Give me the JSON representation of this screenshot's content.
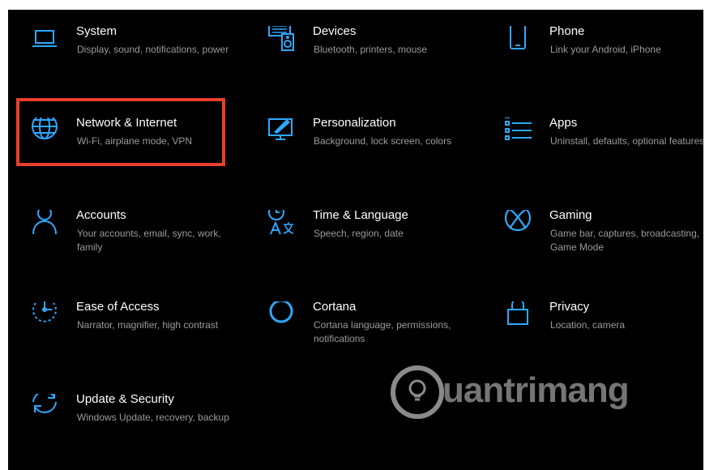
{
  "theme": {
    "accent": "#2ea8ff",
    "highlight": "#e8402b",
    "background": "#000000",
    "title_color": "#ffffff",
    "desc_color": "#9b9b9b"
  },
  "tiles": [
    {
      "icon": "laptop-icon",
      "title": "System",
      "desc": "Display, sound, notifications, power"
    },
    {
      "icon": "keyboard-speaker-icon",
      "title": "Devices",
      "desc": "Bluetooth, printers, mouse"
    },
    {
      "icon": "phone-icon",
      "title": "Phone",
      "desc": "Link your Android, iPhone"
    },
    {
      "icon": "globe-icon",
      "title": "Network & Internet",
      "desc": "Wi-Fi, airplane mode, VPN"
    },
    {
      "icon": "paint-screen-icon",
      "title": "Personalization",
      "desc": "Background, lock screen, colors"
    },
    {
      "icon": "list-icon",
      "title": "Apps",
      "desc": "Uninstall, defaults, optional features"
    },
    {
      "icon": "person-icon",
      "title": "Accounts",
      "desc": "Your accounts, email, sync, work, family"
    },
    {
      "icon": "time-language-icon",
      "title": "Time & Language",
      "desc": "Speech, region, date"
    },
    {
      "icon": "xbox-icon",
      "title": "Gaming",
      "desc": "Game bar, captures, broadcasting, Game Mode"
    },
    {
      "icon": "ease-of-access-icon",
      "title": "Ease of Access",
      "desc": "Narrator, magnifier, high contrast"
    },
    {
      "icon": "cortana-icon",
      "title": "Cortana",
      "desc": "Cortana language, permissions, notifications"
    },
    {
      "icon": "lock-icon",
      "title": "Privacy",
      "desc": "Location, camera"
    },
    {
      "icon": "sync-icon",
      "title": "Update & Security",
      "desc": "Windows Update, recovery, backup"
    }
  ],
  "watermark": {
    "text": "uantrimang"
  }
}
